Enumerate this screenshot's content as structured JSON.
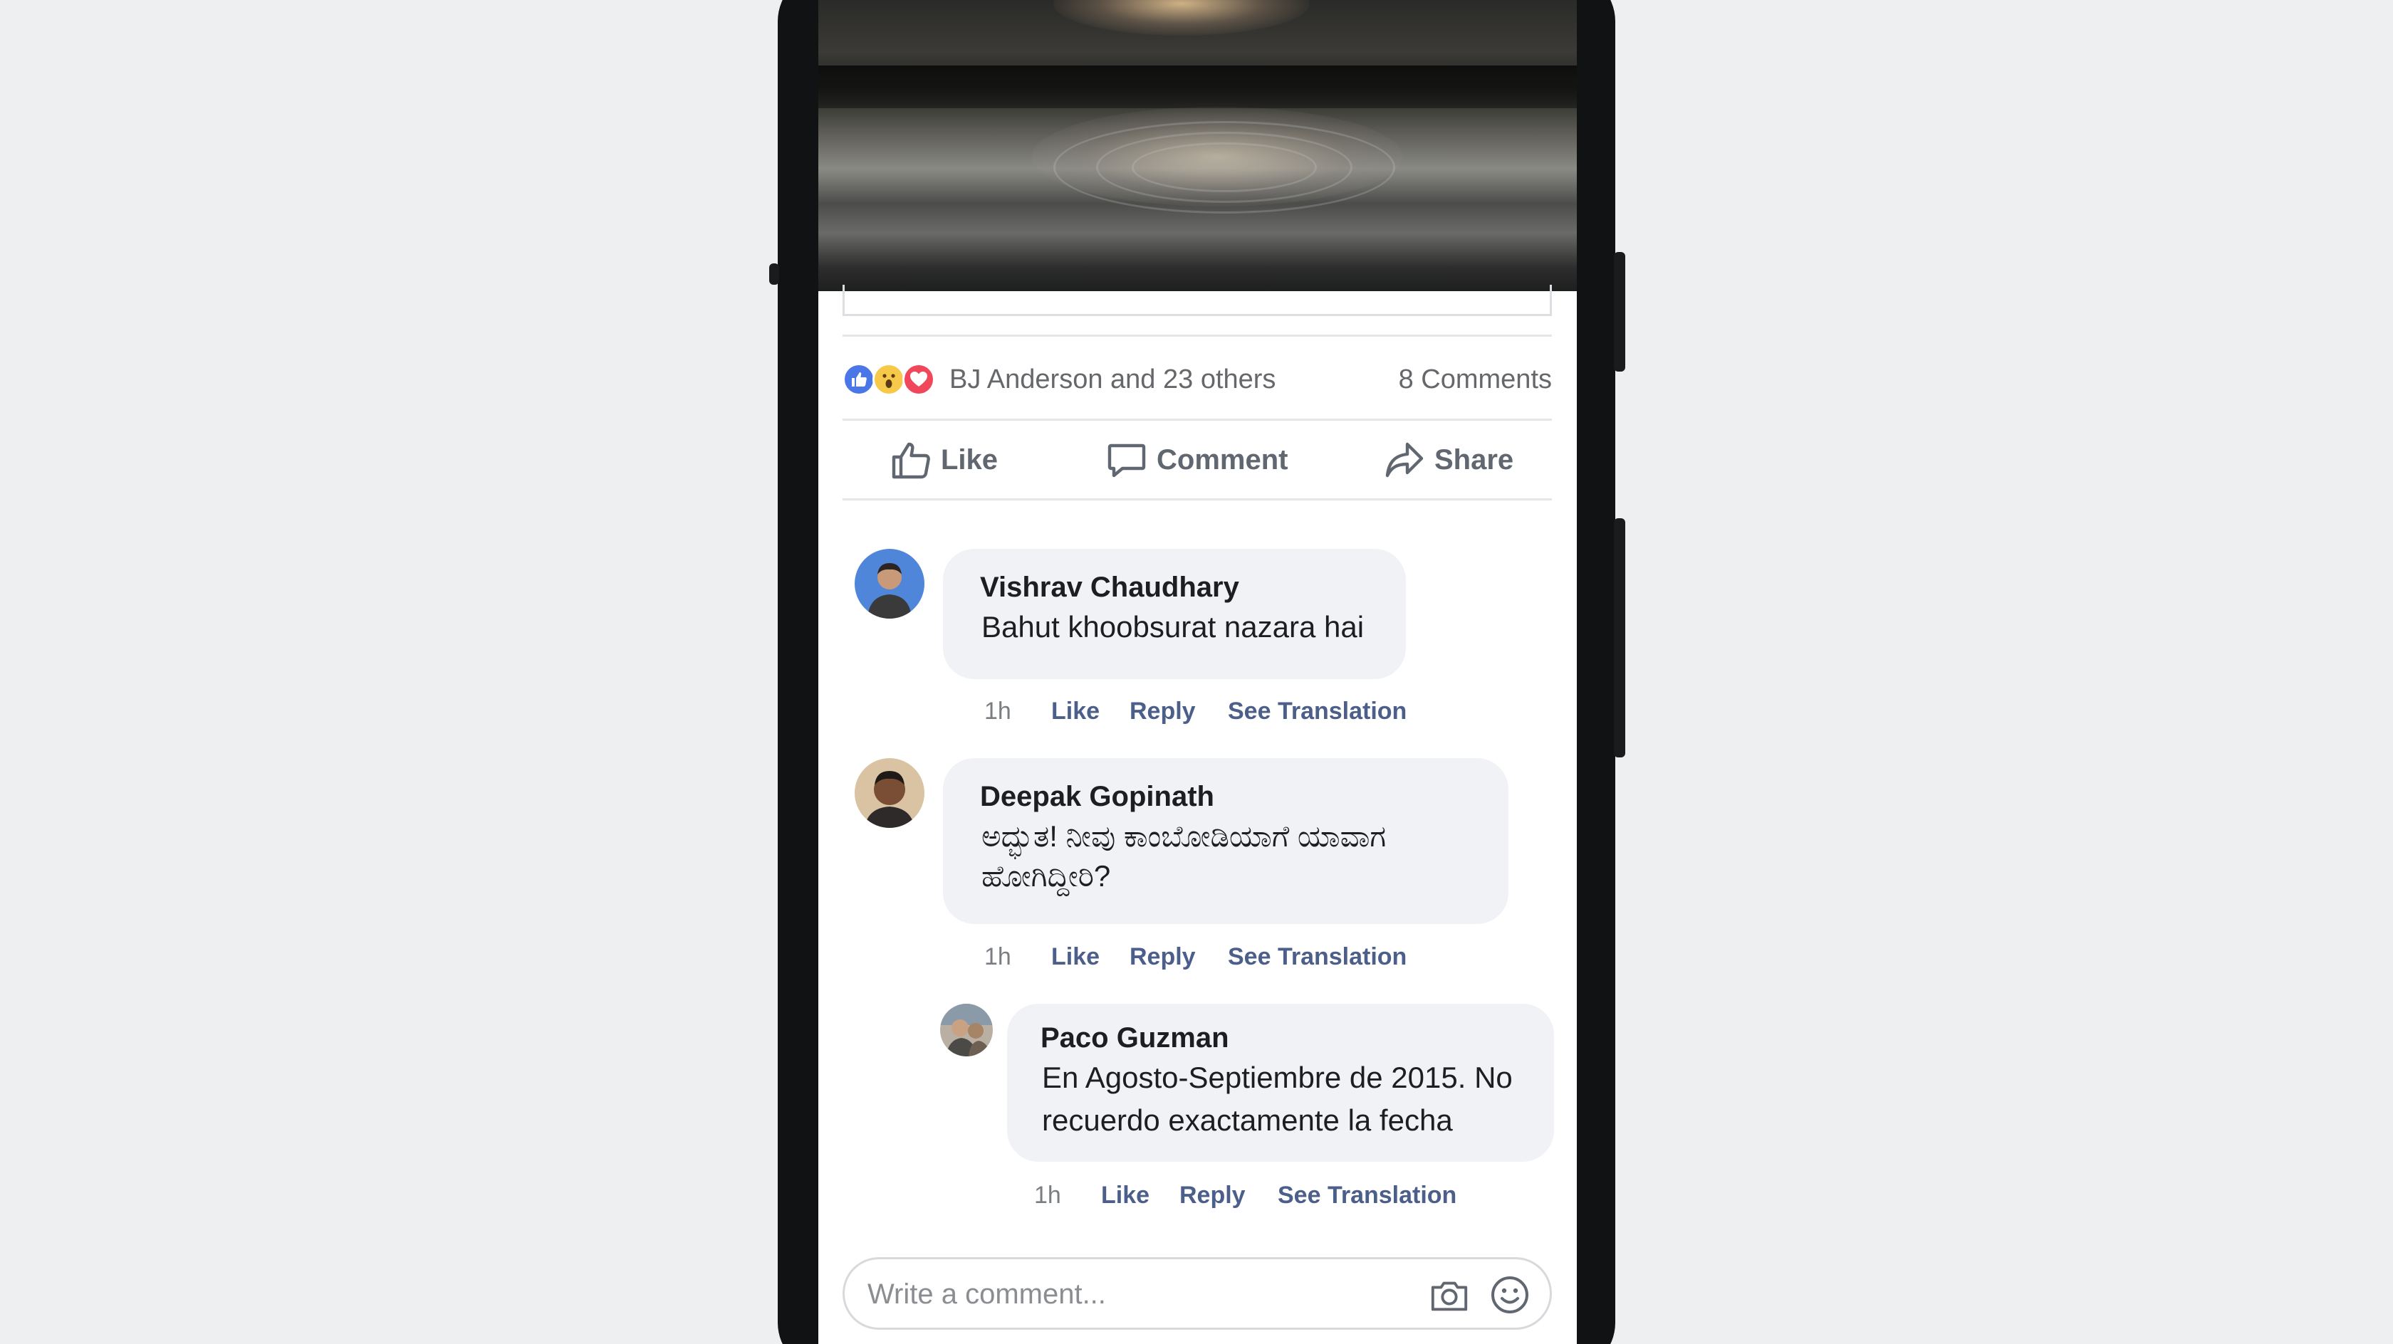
{
  "post": {
    "reactions_text": "BJ Anderson and 23 others",
    "comments_count": "8 Comments",
    "reaction_icons": [
      "like-reaction-icon",
      "wow-reaction-icon",
      "love-reaction-icon"
    ]
  },
  "actions": {
    "like": "Like",
    "comment": "Comment",
    "share": "Share"
  },
  "comments": [
    {
      "author": "Vishrav Chaudhary",
      "text": "Bahut khoobsurat nazara hai",
      "time": "1h",
      "like": "Like",
      "reply": "Reply",
      "translate": "See Translation"
    },
    {
      "author": "Deepak Gopinath",
      "text_line1": "ಅದ್ಭುತ! ನೀವು ಕಾಂಬೋಡಿಯಾಗೆ ಯಾವಾಗ",
      "text_line2": "ಹೋಗಿದ್ದೀರಿ?",
      "time": "1h",
      "like": "Like",
      "reply": "Reply",
      "translate": "See Translation"
    },
    {
      "author": "Paco Guzman",
      "text_line1": "En Agosto-Septiembre de 2015. No",
      "text_line2": "recuerdo exactamente la fecha",
      "time": "1h",
      "like": "Like",
      "reply": "Reply",
      "translate": "See Translation"
    }
  ],
  "composer": {
    "placeholder": "Write a comment..."
  },
  "colors": {
    "link_blue": "#4b5f8a",
    "like_blue": "#4a76e8",
    "love_red": "#f0475a",
    "wow_yellow": "#f7c94b",
    "bubble_bg": "#f0f2f5"
  }
}
